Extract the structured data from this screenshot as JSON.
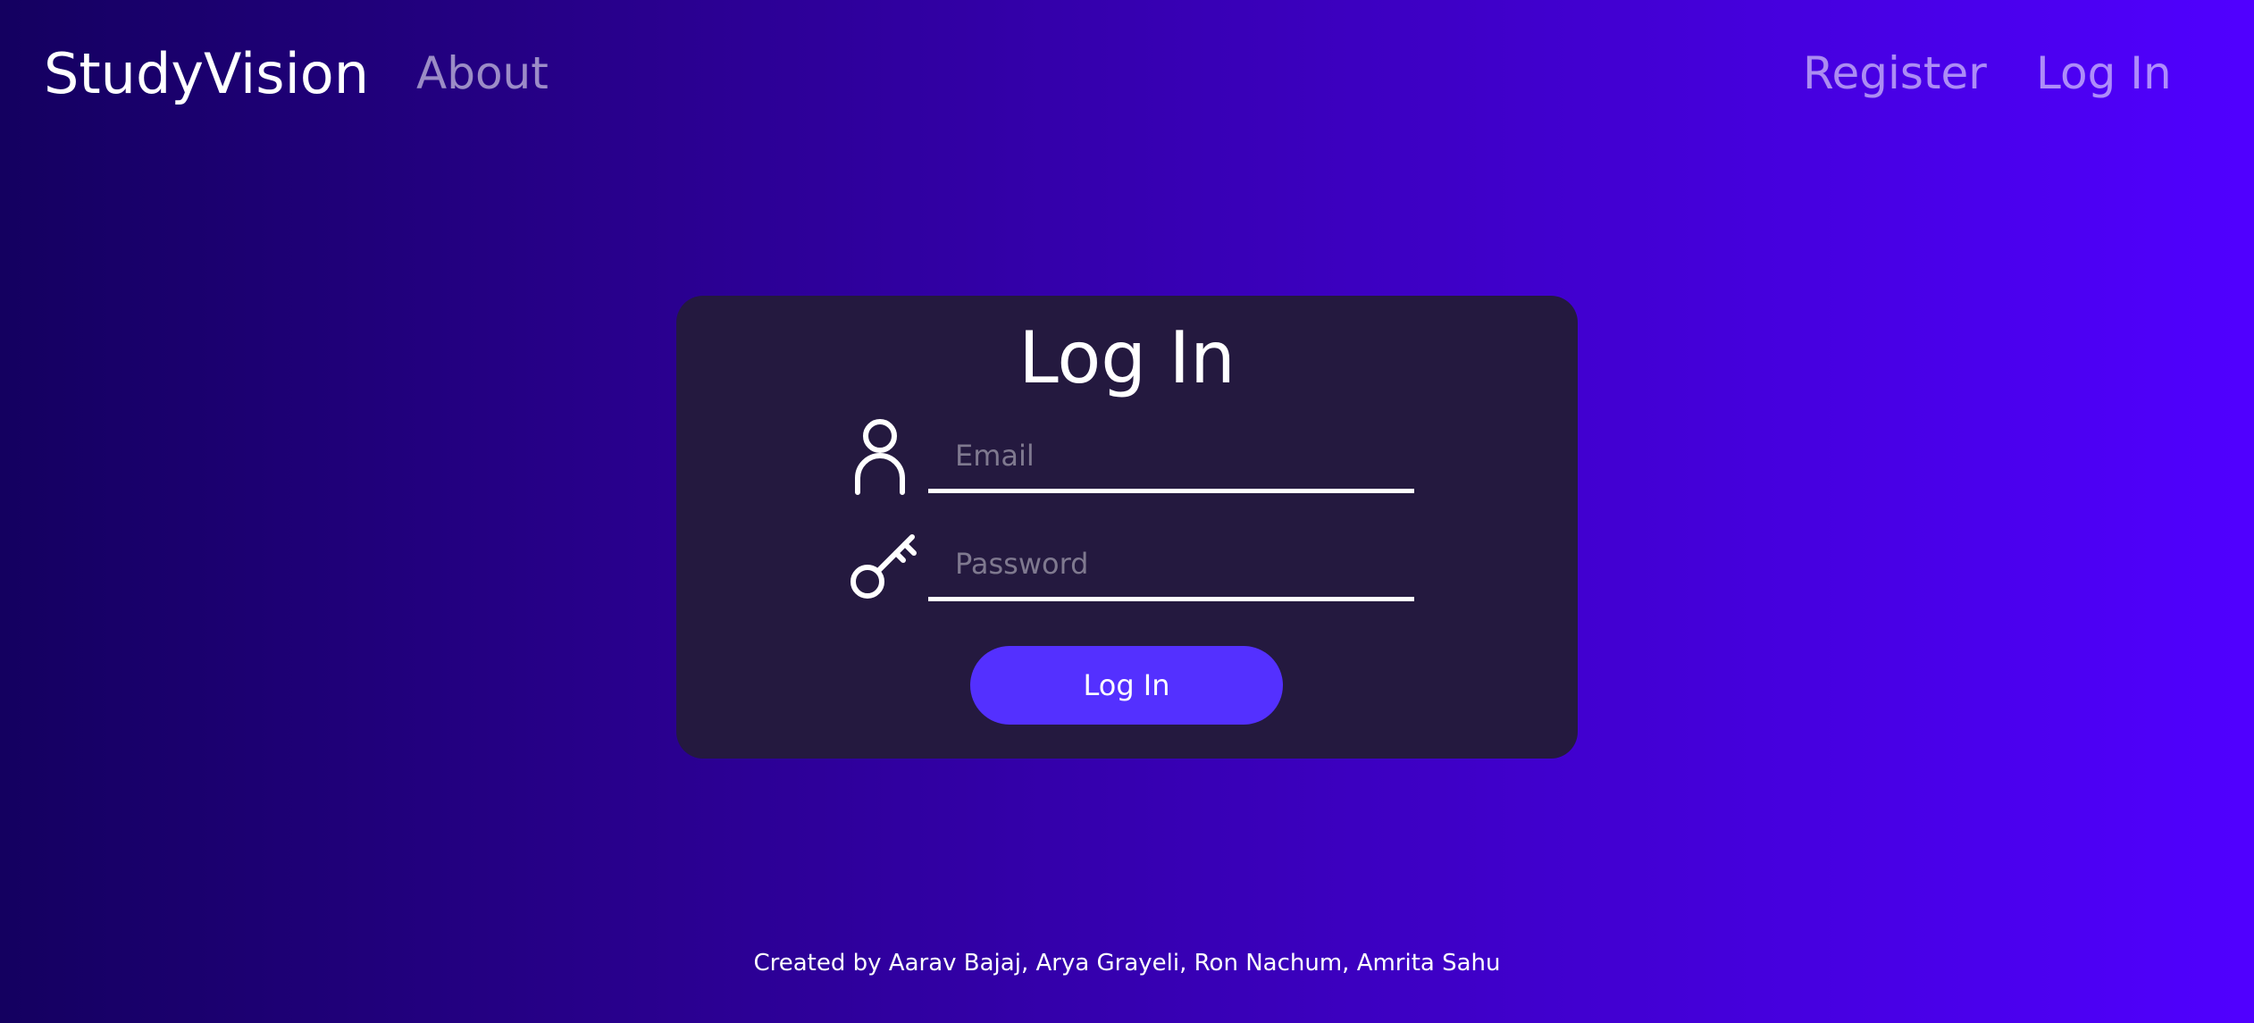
{
  "navbar": {
    "brand": "StudyVision",
    "about_label": "About",
    "register_label": "Register",
    "login_label": "Log In"
  },
  "login_card": {
    "title": "Log In",
    "email": {
      "placeholder": "Email",
      "value": "",
      "icon": "user-icon"
    },
    "password": {
      "placeholder": "Password",
      "value": "",
      "icon": "key-icon"
    },
    "submit_label": "Log In"
  },
  "footer": {
    "credits": "Created by Aarav Bajaj, Arya Grayeli, Ron Nachum, Amrita Sahu"
  },
  "colors": {
    "background_start": "#140060",
    "background_end": "#5000ff",
    "card_background": "#24193f",
    "button_accent": "#5430ff",
    "nav_link": "#a999e0"
  }
}
